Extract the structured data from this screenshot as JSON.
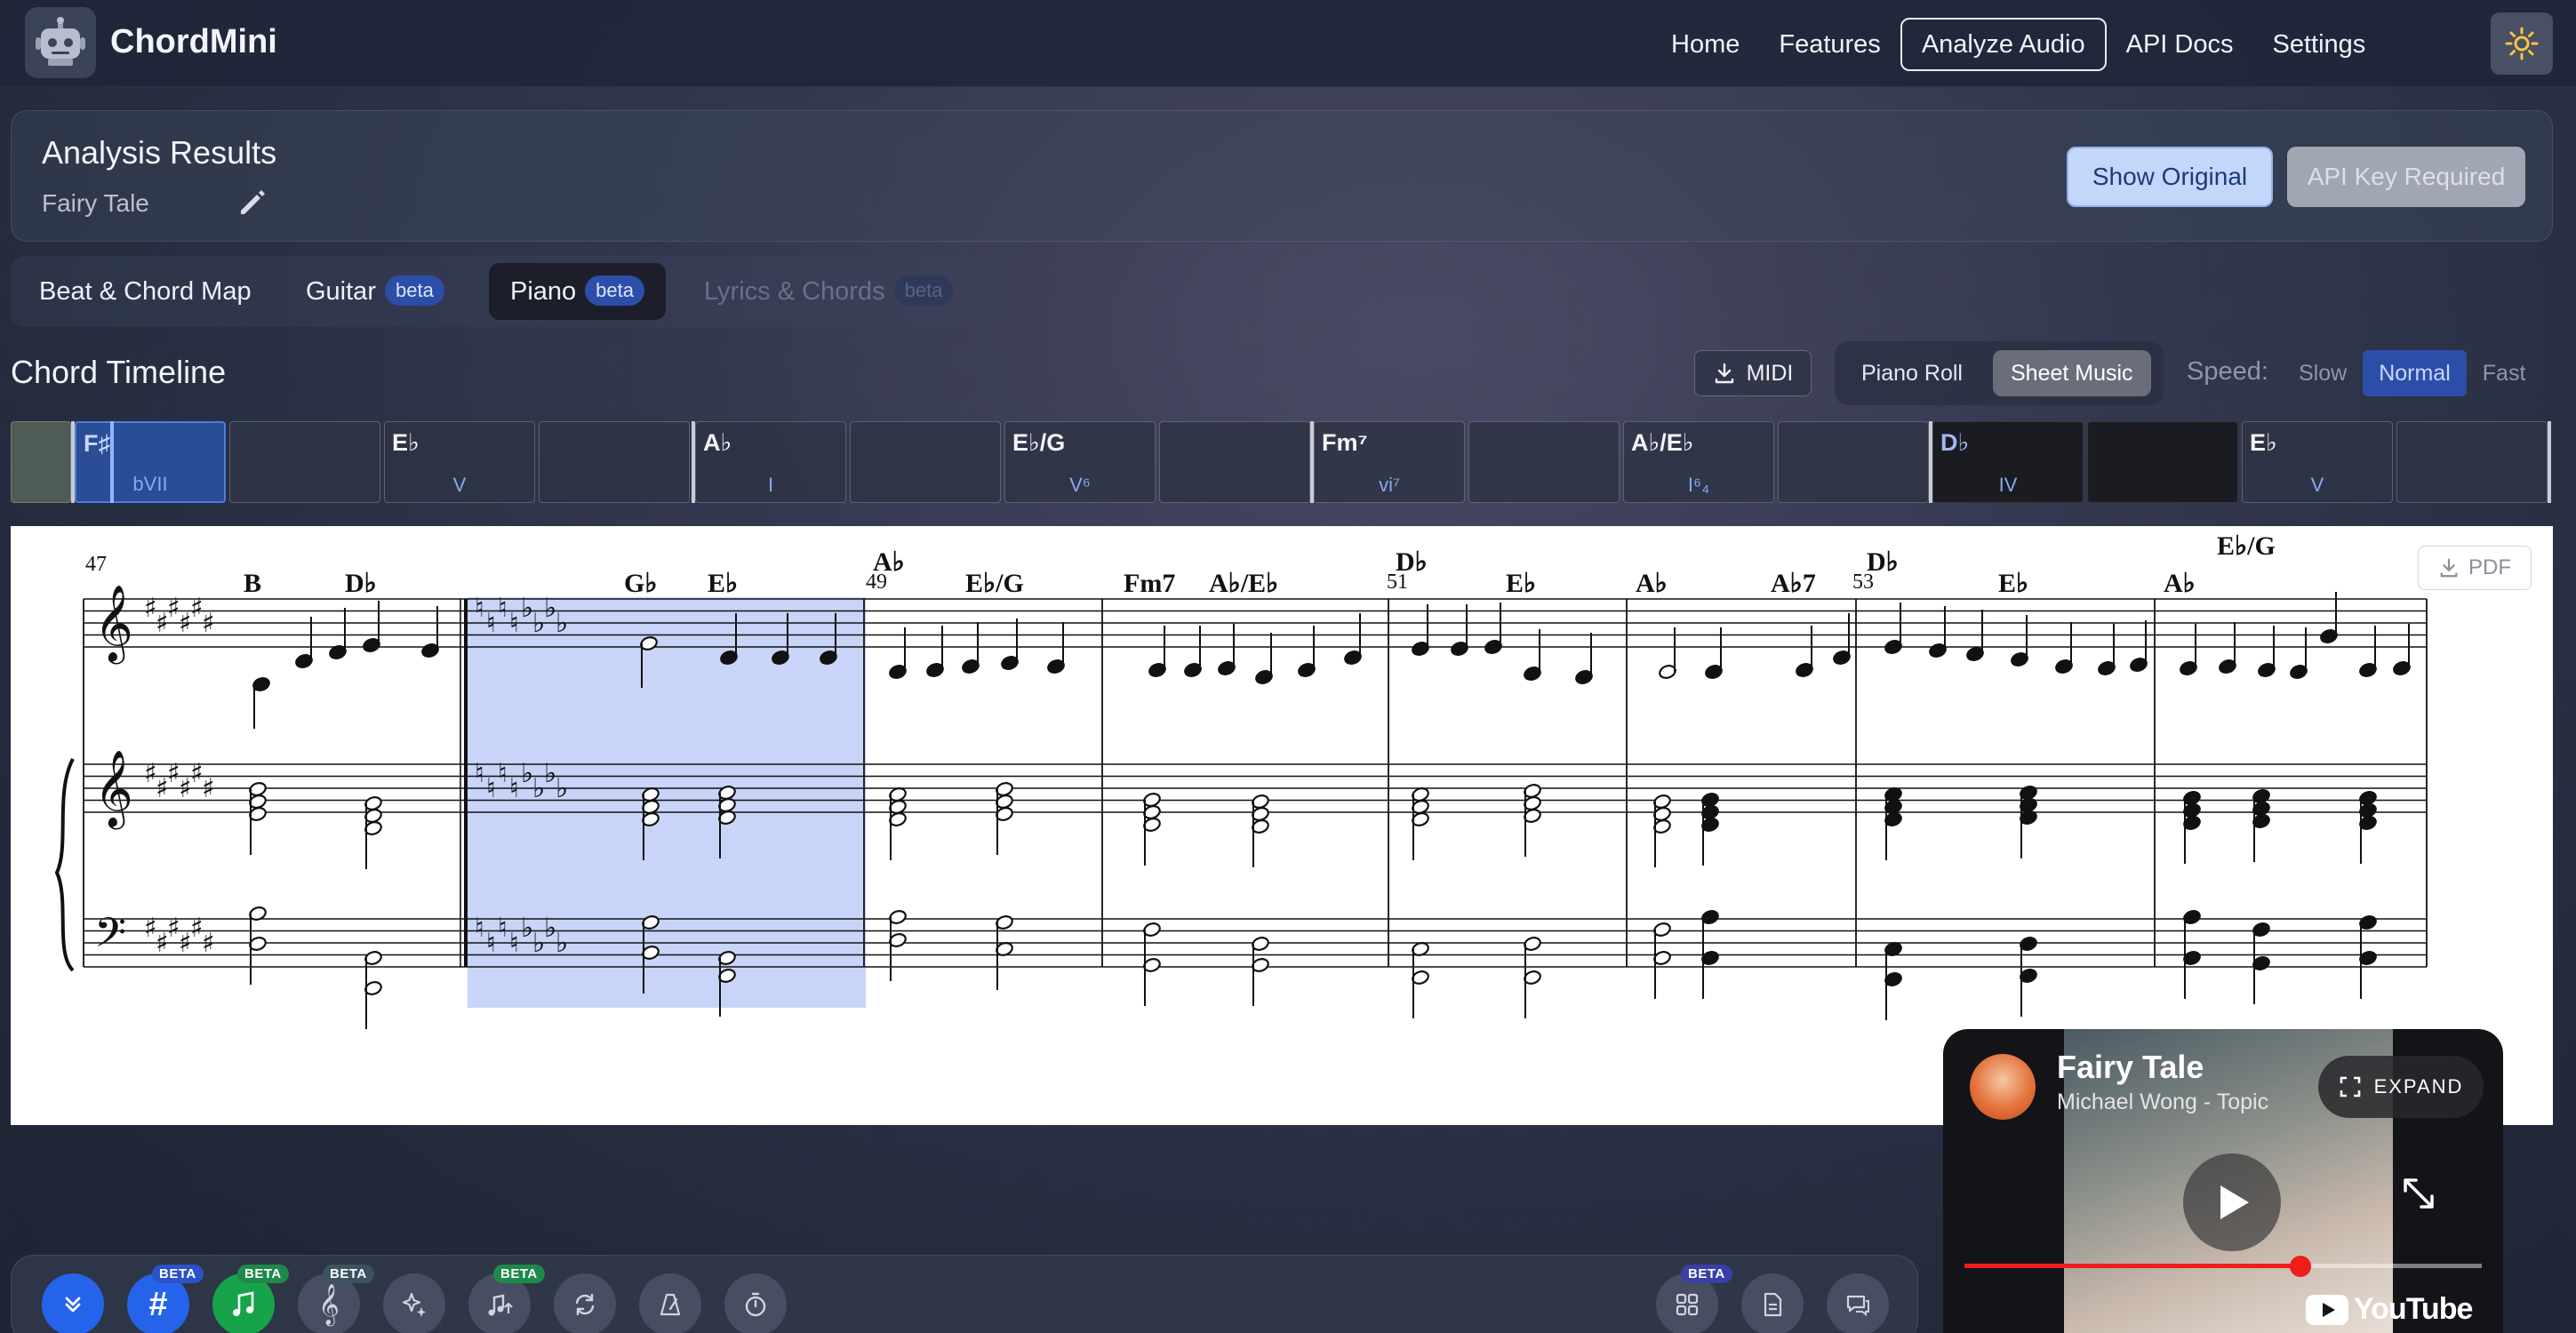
{
  "app": {
    "name": "ChordMini"
  },
  "nav": {
    "items": [
      "Home",
      "Features",
      "Analyze Audio",
      "API Docs",
      "Settings"
    ],
    "active": "Analyze Audio"
  },
  "results": {
    "title": "Analysis Results",
    "song": "Fairy Tale",
    "show_original": "Show Original",
    "api_key_required": "API Key Required"
  },
  "tabs": [
    {
      "label": "Beat & Chord Map",
      "badge": ""
    },
    {
      "label": "Guitar",
      "badge": "beta"
    },
    {
      "label": "Piano",
      "badge": "beta"
    },
    {
      "label": "Lyrics & Chords",
      "badge": "beta"
    }
  ],
  "timeline": {
    "title": "Chord Timeline",
    "midi": "MIDI",
    "views": [
      "Piano Roll",
      "Sheet Music"
    ],
    "active_view": "Sheet Music",
    "speed_label": "Speed:",
    "speeds": [
      "Slow",
      "Normal",
      "Fast"
    ],
    "active_speed": "Normal"
  },
  "chord_cells": [
    {
      "chord": "",
      "roman": ""
    },
    {
      "chord": "F♯",
      "roman": "bVII"
    },
    {
      "chord": "",
      "roman": ""
    },
    {
      "chord": "E♭",
      "roman": "V"
    },
    {
      "chord": "",
      "roman": ""
    },
    {
      "chord": "A♭",
      "roman": "I"
    },
    {
      "chord": "",
      "roman": ""
    },
    {
      "chord": "E♭/G",
      "roman": "V⁶"
    },
    {
      "chord": "",
      "roman": ""
    },
    {
      "chord": "Fm⁷",
      "roman": "vi⁷"
    },
    {
      "chord": "",
      "roman": ""
    },
    {
      "chord": "A♭/E♭",
      "roman": "I⁶₄"
    },
    {
      "chord": "",
      "roman": ""
    },
    {
      "chord": "D♭",
      "roman": "IV"
    },
    {
      "chord": "",
      "roman": ""
    },
    {
      "chord": "E♭",
      "roman": "V"
    },
    {
      "chord": "",
      "roman": ""
    }
  ],
  "sheet": {
    "pdf": "PDF",
    "measure_numbers": [
      "47",
      "49",
      "51",
      "53"
    ],
    "chord_symbols": [
      "B",
      "D♭",
      "G♭",
      "E♭",
      "A♭",
      "E♭/G",
      "Fm7",
      "A♭/E♭",
      "D♭",
      "E♭",
      "A♭",
      "A♭7",
      "D♭",
      "E♭",
      "E♭/G",
      "A♭"
    ]
  },
  "video": {
    "title": "Fairy Tale",
    "channel": "Michael Wong - Topic",
    "expand": "EXPAND",
    "platform": "YouTube",
    "progress": 0.65
  },
  "toolbar": {
    "tools": [
      {
        "icon": "chevrons-down-icon",
        "badge": ""
      },
      {
        "icon": "roman-numeral-icon",
        "badge": "BETA"
      },
      {
        "icon": "music-note-icon",
        "badge": "BETA"
      },
      {
        "icon": "treble-clef-icon",
        "badge": "BETA"
      },
      {
        "icon": "sparkles-icon",
        "badge": ""
      },
      {
        "icon": "music-upload-icon",
        "badge": "BETA"
      },
      {
        "icon": "loop-icon",
        "badge": ""
      },
      {
        "icon": "metronome-icon",
        "badge": ""
      },
      {
        "icon": "timer-icon",
        "badge": ""
      },
      {
        "icon": "grid-icon",
        "badge": "BETA"
      },
      {
        "icon": "document-icon",
        "badge": ""
      },
      {
        "icon": "chat-icon",
        "badge": ""
      }
    ]
  },
  "colors": {
    "accent": "#2563eb",
    "progress": "#f01d1d",
    "selection": "#c8d4f8"
  }
}
